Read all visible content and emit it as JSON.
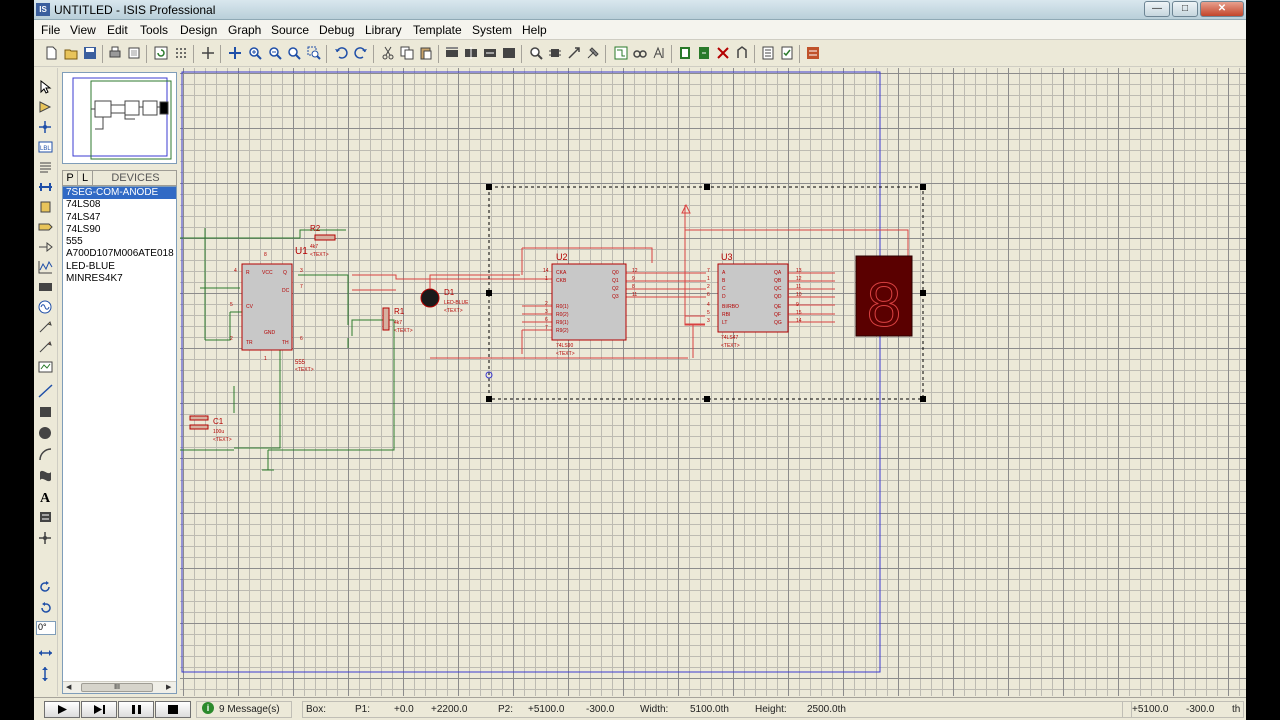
{
  "window": {
    "title": "UNTITLED - ISIS Professional",
    "app_icon": "IS",
    "buttons": [
      "minimize",
      "maximize",
      "close"
    ]
  },
  "menu": [
    "File",
    "View",
    "Edit",
    "Tools",
    "Design",
    "Graph",
    "Source",
    "Debug",
    "Library",
    "Template",
    "System",
    "Help"
  ],
  "devices_panel": {
    "tab_p": "P",
    "tab_l": "L",
    "title": "DEVICES",
    "items": [
      "7SEG-COM-ANODE",
      "74LS08",
      "74LS47",
      "74LS90",
      "555",
      "A700D107M006ATE018",
      "LED-BLUE",
      "MINRES4K7"
    ],
    "selected": 0,
    "scroll_thumb": "III"
  },
  "rotation_value": "0°",
  "schematic": {
    "u1": {
      "ref": "U1",
      "part": "555",
      "text": "<TEXT>",
      "pins": [
        "4",
        "8",
        "3",
        "7",
        "5",
        "2",
        "6",
        "1"
      ],
      "pin_names": [
        "R",
        "VCC",
        "Q",
        "DC",
        "CV",
        "TR",
        "TH",
        "GND"
      ]
    },
    "r2": {
      "ref": "R2",
      "value": "4k7",
      "text": "<TEXT>"
    },
    "r1": {
      "ref": "R1",
      "value": "4k7",
      "text": "<TEXT>"
    },
    "c1": {
      "ref": "C1",
      "value": "100u",
      "text": "<TEXT>"
    },
    "d1": {
      "ref": "D1",
      "part": "LED-BLUE",
      "text": "<TEXT>"
    },
    "u2": {
      "ref": "U2",
      "part": "74LS90",
      "text": "<TEXT>",
      "left_pins": [
        "14",
        "1",
        "2",
        "3",
        "6",
        "7"
      ],
      "left_names": [
        "CKA",
        "CKB",
        "R0(1)",
        "R0(2)",
        "R9(1)",
        "R9(2)"
      ],
      "right_pins": [
        "12",
        "9",
        "8",
        "11"
      ],
      "right_names": [
        "Q0",
        "Q1",
        "Q2",
        "Q3"
      ]
    },
    "u3": {
      "ref": "U3",
      "part": "74LS47",
      "text": "<TEXT>",
      "left_pins": [
        "7",
        "1",
        "2",
        "6",
        "4",
        "5",
        "3"
      ],
      "left_names": [
        "A",
        "B",
        "C",
        "D",
        "BI/RBO",
        "RBI",
        "LT"
      ],
      "right_pins": [
        "13",
        "12",
        "11",
        "10",
        "9",
        "15",
        "14"
      ],
      "right_names": [
        "QA",
        "QB",
        "QC",
        "QD",
        "QE",
        "QF",
        "QG"
      ]
    },
    "display": {
      "glyph": "8"
    }
  },
  "status": {
    "messages": "9 Message(s)",
    "box_label": "Box:",
    "p1_label": "P1:",
    "p1_x": "+0.0",
    "p1_y": "+2200.0",
    "p2_label": "P2:",
    "p2_x": "+5100.0",
    "p2_y": "-300.0",
    "width_label": "Width:",
    "width_value": "5100.0th",
    "height_label": "Height:",
    "height_value": "2500.0th",
    "coord_x": "+5100.0",
    "coord_y": "-300.0",
    "unit": "th"
  },
  "colors": {
    "wire": "#d94141",
    "component": "#b40000",
    "selection": "#000000",
    "border": "#3b3bd0",
    "green_wire": "#2d7a2d"
  }
}
